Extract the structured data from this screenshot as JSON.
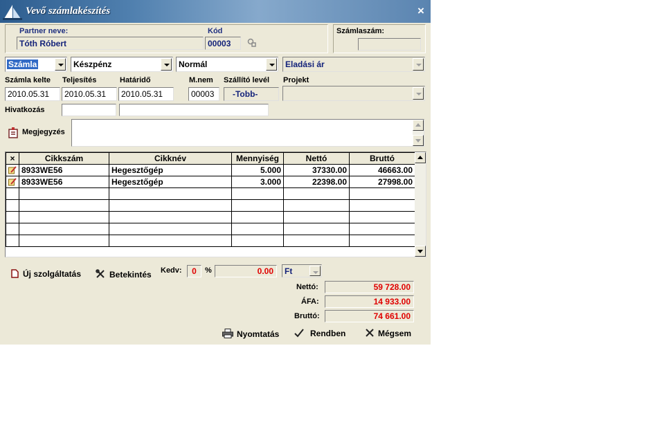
{
  "window": {
    "title": "Vevő számlakészítés",
    "close_label": "×"
  },
  "partner": {
    "name_label": "Partner neve:",
    "name_value": "Tóth Róbert",
    "code_label": "Kód",
    "code_value": "00003"
  },
  "invoice_no": {
    "label": "Számlaszám:",
    "value": ""
  },
  "selectors": {
    "doc_type": "Számla",
    "payment": "Készpénz",
    "mode": "Normál",
    "price": "Eladási ár"
  },
  "dates": {
    "issue_label": "Számla kelte",
    "issue_value": "2010.05.31",
    "fulfil_label": "Teljesítés",
    "fulfil_value": "2010.05.31",
    "due_label": "Határidő",
    "due_value": "2010.05.31",
    "unit_label": "M.nem",
    "unit_value": "00003",
    "delivery_label": "Szállító levél",
    "delivery_value": "-Tobb-",
    "project_label": "Projekt",
    "project_value": ""
  },
  "reference": {
    "label": "Hivatkozás",
    "value1": "",
    "value2": ""
  },
  "note": {
    "label": "Megjegyzés",
    "value": ""
  },
  "grid": {
    "headers": [
      "×",
      "Cikkszám",
      "Cikknév",
      "Mennyiség",
      "Nettó",
      "Bruttó"
    ],
    "rows": [
      {
        "code": "8933WE56",
        "name": "Hegesztőgép",
        "qty": "5.000",
        "net": "37330.00",
        "gross": "46663.00"
      },
      {
        "code": "8933WE56",
        "name": "Hegesztőgép",
        "qty": "3.000",
        "net": "22398.00",
        "gross": "27998.00"
      }
    ]
  },
  "actions": {
    "new_service": "Új szolgáltatás",
    "preview": "Betekintés"
  },
  "discount": {
    "label": "Kedv:",
    "value": "0",
    "pct_label": "%",
    "amount": "0.00",
    "currency": "Ft"
  },
  "totals": {
    "net_label": "Nettó:",
    "net_value": "59 728.00",
    "vat_label": "ÁFA:",
    "vat_value": "14 933.00",
    "gross_label": "Bruttó:",
    "gross_value": "74 661.00"
  },
  "footer": {
    "print": "Nyomtatás",
    "ok": "Rendben",
    "cancel": "Mégsem"
  },
  "colors": {
    "title_bar": "#4f7fae",
    "window_bg": "#ece9d8",
    "totals_text": "#e00000",
    "selection": "#316ac5"
  },
  "icons": [
    "app-logo-icon",
    "close-icon",
    "link-icon",
    "note-icon",
    "delete-column-icon",
    "row-edit-icon",
    "document-icon",
    "tools-icon",
    "printer-icon",
    "check-icon",
    "cross-icon"
  ]
}
